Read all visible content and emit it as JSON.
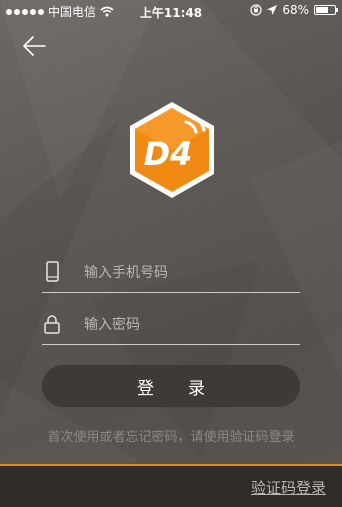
{
  "status_bar": {
    "carrier": "中国电信",
    "time": "上午11:48",
    "battery_percent": "68%",
    "battery_level": 0.68,
    "signal_dots": 5
  },
  "nav": {
    "back_icon": "arrow-left-icon"
  },
  "logo": {
    "text": "D4",
    "brand_color": "#f08a12",
    "accent_color": "#e2620a"
  },
  "form": {
    "phone_placeholder": "输入手机号码",
    "phone_value": "",
    "phone_icon": "phone-icon",
    "password_placeholder": "输入密码",
    "password_value": "",
    "password_icon": "lock-icon",
    "login_label": "登录"
  },
  "hint_text": "首次使用或者忘记密码，请使用验证码登录",
  "footer": {
    "sms_login_label": "验证码登录",
    "divider_color": "#e08a1e"
  }
}
